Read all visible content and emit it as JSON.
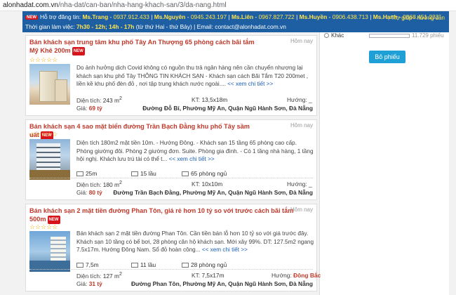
{
  "browser": {
    "url_host": "alonhadat.com.vn",
    "url_path": "/nha-dat/can-ban/nha-hang-khach-san/3/da-nang.html"
  },
  "header": {
    "new_badge": "NEW",
    "support_label": "Hỗ trợ đăng tin:",
    "contacts": [
      {
        "name": "Ms.Trang",
        "phone": "0937.912.433"
      },
      {
        "name": "Ms.Nguyên",
        "phone": "0945.243.197"
      },
      {
        "name": "Ms.Liên",
        "phone": "0967.827.722"
      },
      {
        "name": "Ms.Huyền",
        "phone": "0906.438.713"
      },
      {
        "name": "Ms.Hạnh",
        "phone": "0868.451.233"
      }
    ],
    "hours_label": "Thời gian làm việc:",
    "hours_1": "7h30 - 12h; 14h - 17h",
    "hours_note": "(từ thứ Hai - thứ Bảy) | Email:",
    "email": "contact@alonhadat.com.vn",
    "help_link": "Trợ giúp - hướng dẫn"
  },
  "sidebar": {
    "poll_option": "Khác",
    "poll_count": "11.729 phiếu",
    "poll_fraction": 0.0,
    "vote_button": "Bỏ phiếu"
  },
  "listings": [
    {
      "title": "Bán khách sạn trung tâm khu phố Tây An Thượng 65 phòng cách bãi tắm Mỹ Khê 200m",
      "badge": "NEW",
      "time": "Hôm nay",
      "rating": "☆☆☆☆☆",
      "description": "Do ảnh hưởng dịch Covid không có nguồn thu trả ngân hàng nên cần chuyển nhượng lại khách sạn khu phố Tây THÔNG TIN KHÁCH SẠN - Khách sạn cách Bãi Tắm T20 200met , liền kề khu phố đèn đỏ , nơi tập trung khách nước ngoài....",
      "more": "<< xem chi tiết >>",
      "area_label": "Diện tích:",
      "area": "243 m",
      "area_sup": "2",
      "size_label": "KT:",
      "size": "13,5x18m",
      "direction_label": "Hướng:",
      "direction": "_",
      "price_label": "Giá:",
      "price": "69 tỷ",
      "address": "Đường Đỗ Bí, Phường Mỹ An, Quận Ngũ Hành Sơn, Đà Nẵng"
    },
    {
      "title": "Bán khách sạn 4 sao mặt biển đường Trần Bạch Đằng khu phố Tây sầm uất",
      "badge": "NEW",
      "time": "Hôm nay",
      "rating": "☆☆☆☆☆",
      "description": "Diện tích 180m2 mặt tiền 10m. - Hướng Đông. - Khách sạn 15 tầng 65 phòng cao cấp. Phòng giường đôi. Phòng 2 giường đơn. Suite. Phòng gia đình. - Có 1 tầng nhà hàng, 1 tầng hội nghị. Khách lưu trú tài có thể t...",
      "more": "<< xem chi tiết >>",
      "road": "25m",
      "floors": "15 lầu",
      "bedrooms": "65 phòng ngủ",
      "area_label": "Diện tích:",
      "area": "180 m",
      "area_sup": "2",
      "size_label": "KT:",
      "size": "10x10m",
      "direction_label": "Hướng:",
      "direction": "_",
      "price_label": "Giá:",
      "price": "80 tỷ",
      "address": "Đường Trần Bạch Đằng, Phường Mỹ An, Quận Ngũ Hành Sơn, Đà Nẵng"
    },
    {
      "title": "Bán khách sạn 2 mặt tiền đường Phan Tôn, giá rẻ hơn 10 tỷ so với trước cách bãi tắm 500m",
      "badge": "NEW",
      "time": "Hôm nay",
      "rating": "☆☆☆☆☆",
      "description": "Bán khách sạn 2 mặt tiền đường Phan Tôn. Cần tiền bán lỗ hơn 10 tỷ so với giá trước đây. Khách sạn 10 tầng có bể bơi, 28 phòng căn hộ khách sạn. Mới xây 99%. DT: 127.5m2 ngang 7.5x17m. Hướng Đông Nam. Sổ đỏ hoàn công...",
      "more": "<< xem chi tiết >>",
      "road": "7,5m",
      "floors": "11 lầu",
      "bedrooms": "28 phòng ngủ",
      "area_label": "Diện tích:",
      "area": "127 m",
      "area_sup": "2",
      "size_label": "KT:",
      "size": "7,5x17m",
      "direction_label": "Hướng:",
      "direction": "Đông Bắc",
      "price_label": "Giá:",
      "price": "31 tỷ",
      "address": "Đường Phan Tôn, Phường Mỹ An, Quận Ngũ Hành Sơn, Đà Nẵng"
    }
  ]
}
